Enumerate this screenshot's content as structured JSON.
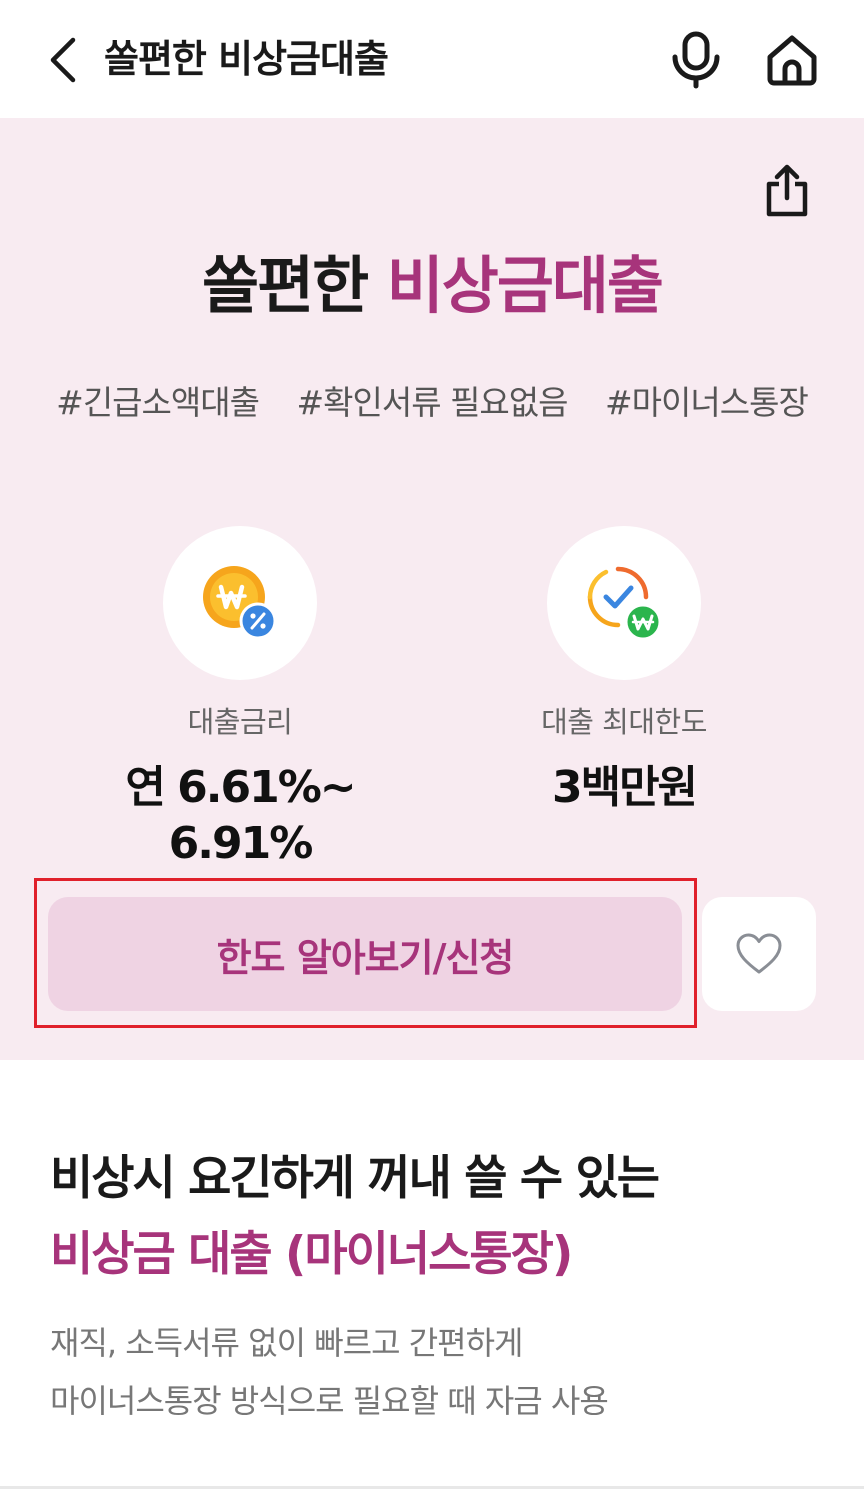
{
  "header": {
    "title": "쏠편한 비상금대출",
    "back_icon": "chevron-left-icon",
    "mic_icon": "microphone-icon",
    "home_icon": "home-icon"
  },
  "hero": {
    "share_icon": "share-icon",
    "title_prefix": "쏠편한 ",
    "title_accent": "비상금대출",
    "accent_color": "#a7347b",
    "background_color": "#f8ebf1",
    "tags": [
      "#긴급소액대출",
      "#확인서류 필요없음",
      "#마이너스통장"
    ]
  },
  "stats": [
    {
      "icon": "won-percent-coin-icon",
      "label": "대출금리",
      "value": "연 6.61%~ 6.91%"
    },
    {
      "icon": "check-won-gauge-icon",
      "label": "대출 최대한도",
      "value": "3백만원"
    }
  ],
  "cta": {
    "label": "한도 알아보기/신청",
    "favorite_icon": "heart-outline-icon"
  },
  "section": {
    "headline_line1": "비상시 요긴하게 꺼내 쓸 수 있는",
    "headline_line2": "비상금 대출 (마이너스통장)",
    "desc_line1": "재직, 소득서류 없이 빠르고 간편하게",
    "desc_line2": "마이너스통장 방식으로 필요할 때 자금 사용"
  }
}
